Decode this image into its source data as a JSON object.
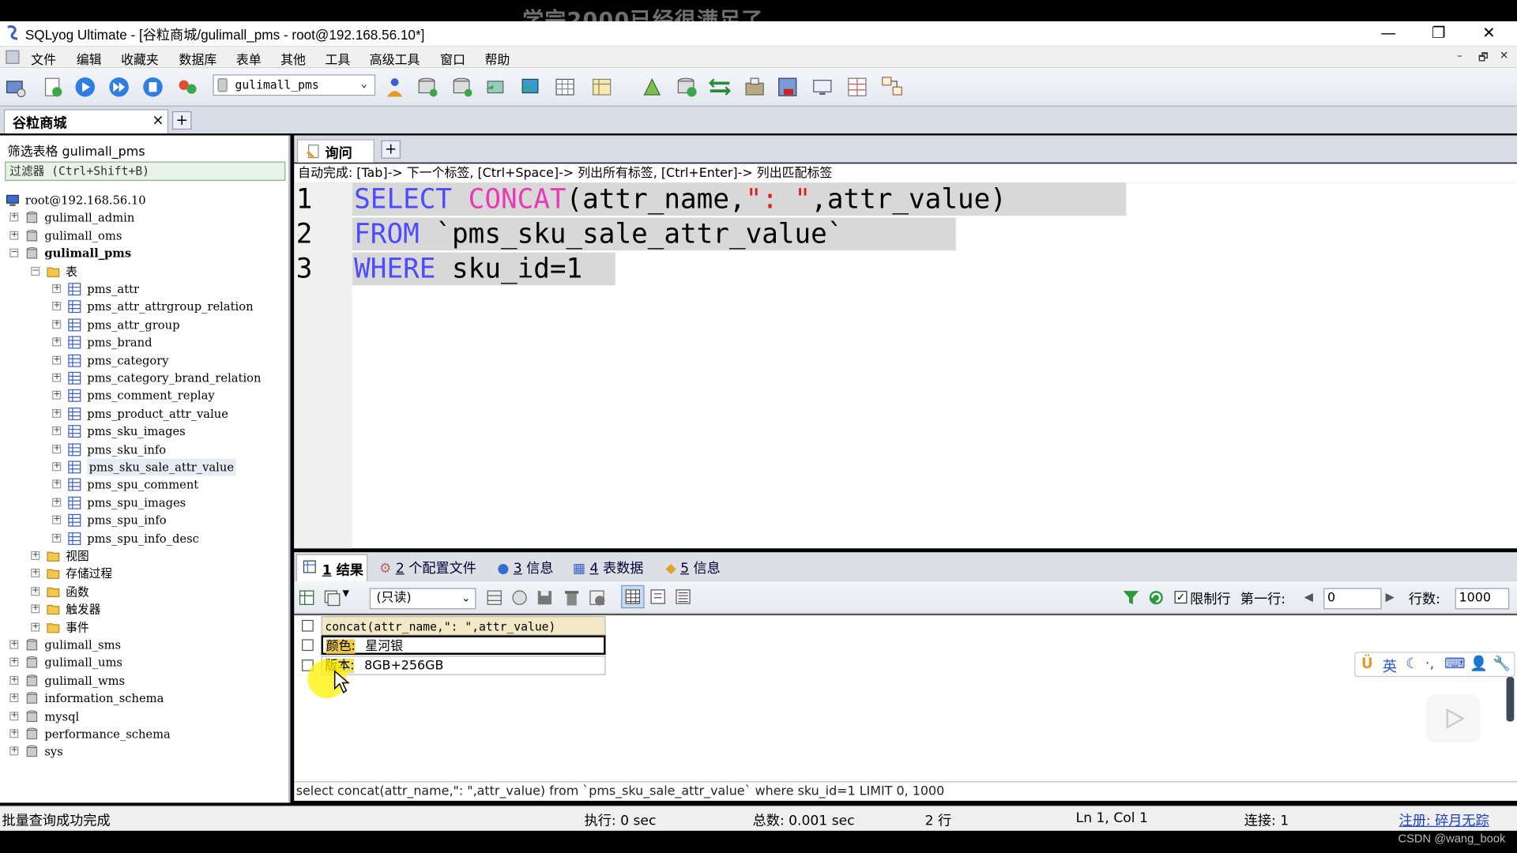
{
  "overlay_caption": "学完2000已经很满足了",
  "window": {
    "title": "SQLyog Ultimate - [谷粒商城/gulimall_pms - root@192.168.56.10*]",
    "minimize": "—",
    "restore": "❐",
    "close": "✕"
  },
  "menu": {
    "items": [
      "文件",
      "编辑",
      "收藏夹",
      "数据库",
      "表单",
      "其他",
      "工具",
      "高级工具",
      "窗口",
      "帮助"
    ],
    "mdi_controls": [
      "–",
      "🗗",
      "✕"
    ]
  },
  "toolbar": {
    "db_select_value": "gulimall_pms"
  },
  "connection_tab": {
    "label": "谷粒商城",
    "close": "×",
    "add": "+"
  },
  "left_panel": {
    "filter_label": "筛选表格 gulimall_pms",
    "filter_placeholder": "过滤器 (Ctrl+Shift+B)",
    "root": "root@192.168.56.10",
    "databases_before": [
      "gulimall_admin",
      "gulimall_oms"
    ],
    "active_db": "gulimall_pms",
    "tables_folder": "表",
    "tables": [
      "pms_attr",
      "pms_attr_attrgroup_relation",
      "pms_attr_group",
      "pms_brand",
      "pms_category",
      "pms_category_brand_relation",
      "pms_comment_replay",
      "pms_product_attr_value",
      "pms_sku_images",
      "pms_sku_info",
      "pms_sku_sale_attr_value",
      "pms_spu_comment",
      "pms_spu_images",
      "pms_spu_info",
      "pms_spu_info_desc"
    ],
    "selected_table": "pms_sku_sale_attr_value",
    "other_folders": [
      "视图",
      "存储过程",
      "函数",
      "触发器",
      "事件"
    ],
    "databases_after": [
      "gulimall_sms",
      "gulimall_ums",
      "gulimall_wms",
      "information_schema",
      "mysql",
      "performance_schema",
      "sys"
    ]
  },
  "query_tabs": {
    "active": "询问",
    "add": "+"
  },
  "autocomplete_hint": "自动完成: [Tab]-> 下一个标签, [Ctrl+Space]-> 列出所有标签, [Ctrl+Enter]-> 列出匹配标签",
  "editor": {
    "line_numbers": [
      "1",
      "2",
      "3"
    ],
    "line1": {
      "kw": "SELECT",
      "fn": "CONCAT",
      "p1": "(attr_name,",
      "str": "\": \"",
      "p2": ",attr_value)"
    },
    "line2": {
      "kw": "FROM",
      "p1": "`pms_sku_sale_attr_value`"
    },
    "line3": {
      "kw": "WHERE",
      "p1": "sku_id=1"
    }
  },
  "result_tabs": [
    {
      "num": "1",
      "label": "结果"
    },
    {
      "num": "2",
      "label": "个配置文件"
    },
    {
      "num": "3",
      "label": "信息"
    },
    {
      "num": "4",
      "label": "表数据"
    },
    {
      "num": "5",
      "label": "信息"
    }
  ],
  "result_toolbar": {
    "mode": "(只读)",
    "limit_label": "限制行",
    "first_row_label": "第一行:",
    "first_row_value": "0",
    "rows_label": "行数:",
    "rows_value": "1000"
  },
  "result_grid": {
    "header": "concat(attr_name,\": \",attr_value)",
    "rows": [
      {
        "label": "颜色:",
        "value": "星河银"
      },
      {
        "label": "版本:",
        "value": "8GB+256GB"
      }
    ]
  },
  "query_status": "select concat(attr_name,\": \",attr_value) from `pms_sku_sale_attr_value` where sku_id=1 LIMIT 0, 1000",
  "statusbar": {
    "message": "批量查询成功完成",
    "exec": "执行: 0 sec",
    "total": "总数: 0.001 sec",
    "rows": "2 行",
    "position": "Ln 1, Col 1",
    "connections": "连接: 1",
    "register": "注册: 碎月无踪"
  },
  "ime": {
    "lang": "英"
  },
  "watermark": "CSDN @wang_book",
  "colors": {
    "keyword": "#4b4bff",
    "function": "#e83ab6",
    "string": "#d8201f",
    "link": "#1d3fbf"
  }
}
